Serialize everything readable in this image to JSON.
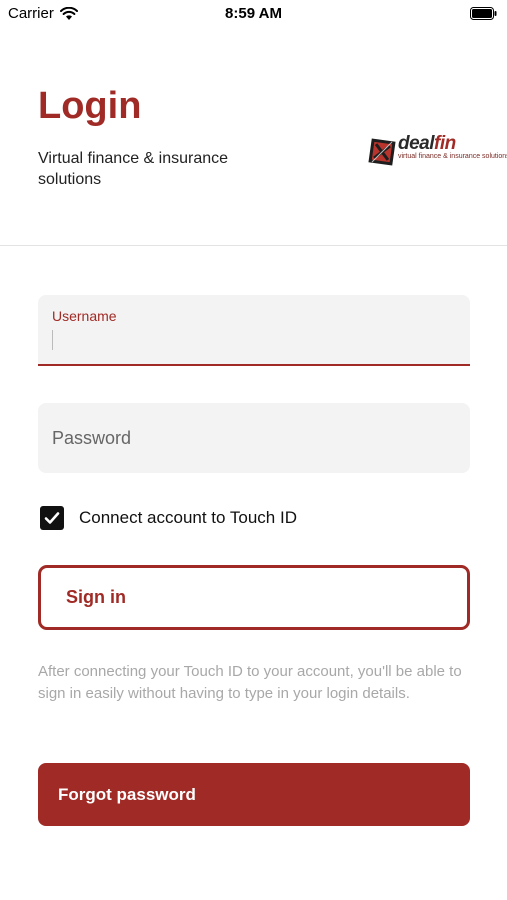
{
  "status_bar": {
    "carrier": "Carrier",
    "time": "8:59 AM"
  },
  "header": {
    "title": "Login",
    "subtitle": "Virtual finance & insurance solutions",
    "logo": {
      "brand_part1": "deal",
      "brand_part2": "fin",
      "tagline": "virtual finance & insurance solutions"
    }
  },
  "form": {
    "username": {
      "label": "Username",
      "value": ""
    },
    "password": {
      "placeholder": "Password",
      "value": ""
    },
    "touch_id": {
      "label": "Connect account to Touch ID",
      "checked": true
    },
    "signin_label": "Sign in",
    "info": "After connecting your Touch ID to your account, you'll be able to sign in easily without having to type in your login details.",
    "forgot_label": "Forgot password"
  },
  "colors": {
    "accent": "#a02a25",
    "field_bg": "#f3f3f3",
    "info_text": "#a8a8a8"
  }
}
